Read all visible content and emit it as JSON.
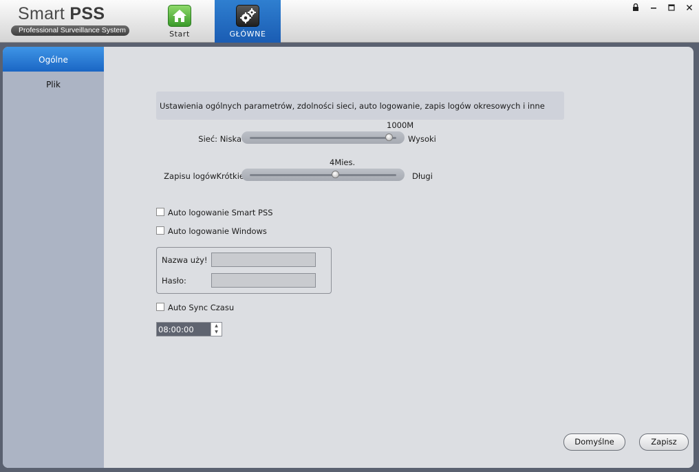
{
  "app": {
    "title_light": "Smart ",
    "title_bold": "PSS",
    "subtitle": "Professional Surveillance System"
  },
  "tabs": [
    {
      "label": "Start",
      "icon": "home-icon",
      "active": false
    },
    {
      "label": "GŁÓWNE",
      "icon": "gears-icon",
      "active": true
    }
  ],
  "window_controls": {
    "lock": "🔒",
    "minimize": "—",
    "maximize": "□",
    "close": "✕"
  },
  "sidebar": {
    "items": [
      {
        "label": "Ogólne",
        "active": true
      },
      {
        "label": "Plik",
        "active": false
      }
    ]
  },
  "settings": {
    "description": "Ustawienia ogólnych parametrów, zdolności sieci, auto logowanie, zapis logów okresowych i inne",
    "network": {
      "label": "Sieć: Niska",
      "value_label": "1000M",
      "high_label": "Wysoki",
      "level": 0.95
    },
    "log": {
      "label": "Zapisu logówKrótkie",
      "value_label": "4Mies.",
      "high_label": "Długi",
      "level": 0.58
    },
    "auto_login_pss": {
      "label": "Auto logowanie Smart PSS",
      "checked": false
    },
    "auto_login_windows": {
      "label": "Auto logowanie Windows",
      "checked": false
    },
    "username_label": "Nazwa uży!",
    "password_label": "Hasło:",
    "auto_sync": {
      "label": "Auto Sync Czasu",
      "checked": false
    },
    "time_value": "08:00:00"
  },
  "buttons": {
    "default": "Domyślne",
    "save": "Zapisz"
  },
  "colors": {
    "accent": "#1a66c4",
    "sidebar": "#acb4c4",
    "panel": "#dcdee2"
  }
}
